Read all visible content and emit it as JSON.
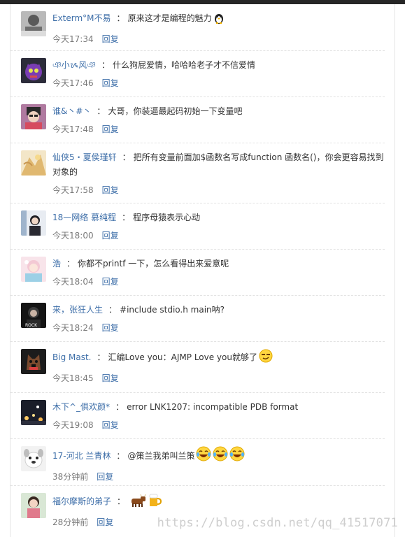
{
  "comments": [
    {
      "name": "Exterm°M不易",
      "text": "原来这才是编程的魅力",
      "emojis": [
        "penguin-emoji"
      ],
      "time": "今天17:34",
      "reply": "回复"
    },
    {
      "name": "ঞ小ᝰ风ঞ",
      "text": "什么狗屁爱情，哈哈哈老子才不信爱情",
      "emojis": [],
      "time": "今天17:46",
      "reply": "回复"
    },
    {
      "name": "谁&丶#丶",
      "text": "大哥，你装逼最起码初始一下变量吧",
      "emojis": [],
      "time": "今天17:48",
      "reply": "回复"
    },
    {
      "name": "仙侠5・夏侯瑾轩",
      "text": "把所有变量前面加$函数名写成function 函数名()，你会更容易找到对象的",
      "emojis": [],
      "time": "今天17:58",
      "reply": "回复"
    },
    {
      "name": "18—网络 慕纯程",
      "text": "程序母猿表示心动",
      "emojis": [],
      "time": "今天18:00",
      "reply": "回复"
    },
    {
      "name": "浩",
      "text": "你都不printf 一下，怎么看得出来爱意呢",
      "emojis": [],
      "time": "今天18:04",
      "reply": "回复"
    },
    {
      "name": "来，张狂人生",
      "text": "#include stdio.h main呐?",
      "emojis": [],
      "time": "今天18:24",
      "reply": "回复"
    },
    {
      "name": "Big Mast.",
      "text": "汇编Love you：AJMP Love you就够了",
      "emojis": [
        "smirk-emoji"
      ],
      "time": "今天18:45",
      "reply": "回复"
    },
    {
      "name": "木下^_俱欢颜*",
      "text": "error LNK1207: incompatible PDB format",
      "emojis": [],
      "time": "今天19:08",
      "reply": "回复"
    },
    {
      "name": "17-河北 兰青林",
      "text": "@策兰我弟叫兰策",
      "emojis": [
        "laugh-cry-emoji",
        "laugh-cry-emoji",
        "laugh-cry-emoji"
      ],
      "time": "38分钟前",
      "reply": "回复"
    },
    {
      "name": "福尔摩斯的弟子",
      "text": "",
      "emojis": [
        "cow-emoji",
        "beer-emoji"
      ],
      "time": "28分钟前",
      "reply": "回复"
    }
  ],
  "separator": "：",
  "watermark": "https://blog.csdn.net/qq_41517071",
  "colors": {
    "link": "#3d6ea8",
    "text": "#333333",
    "meta": "#7a7a7a",
    "divider": "#e2e2e2"
  }
}
